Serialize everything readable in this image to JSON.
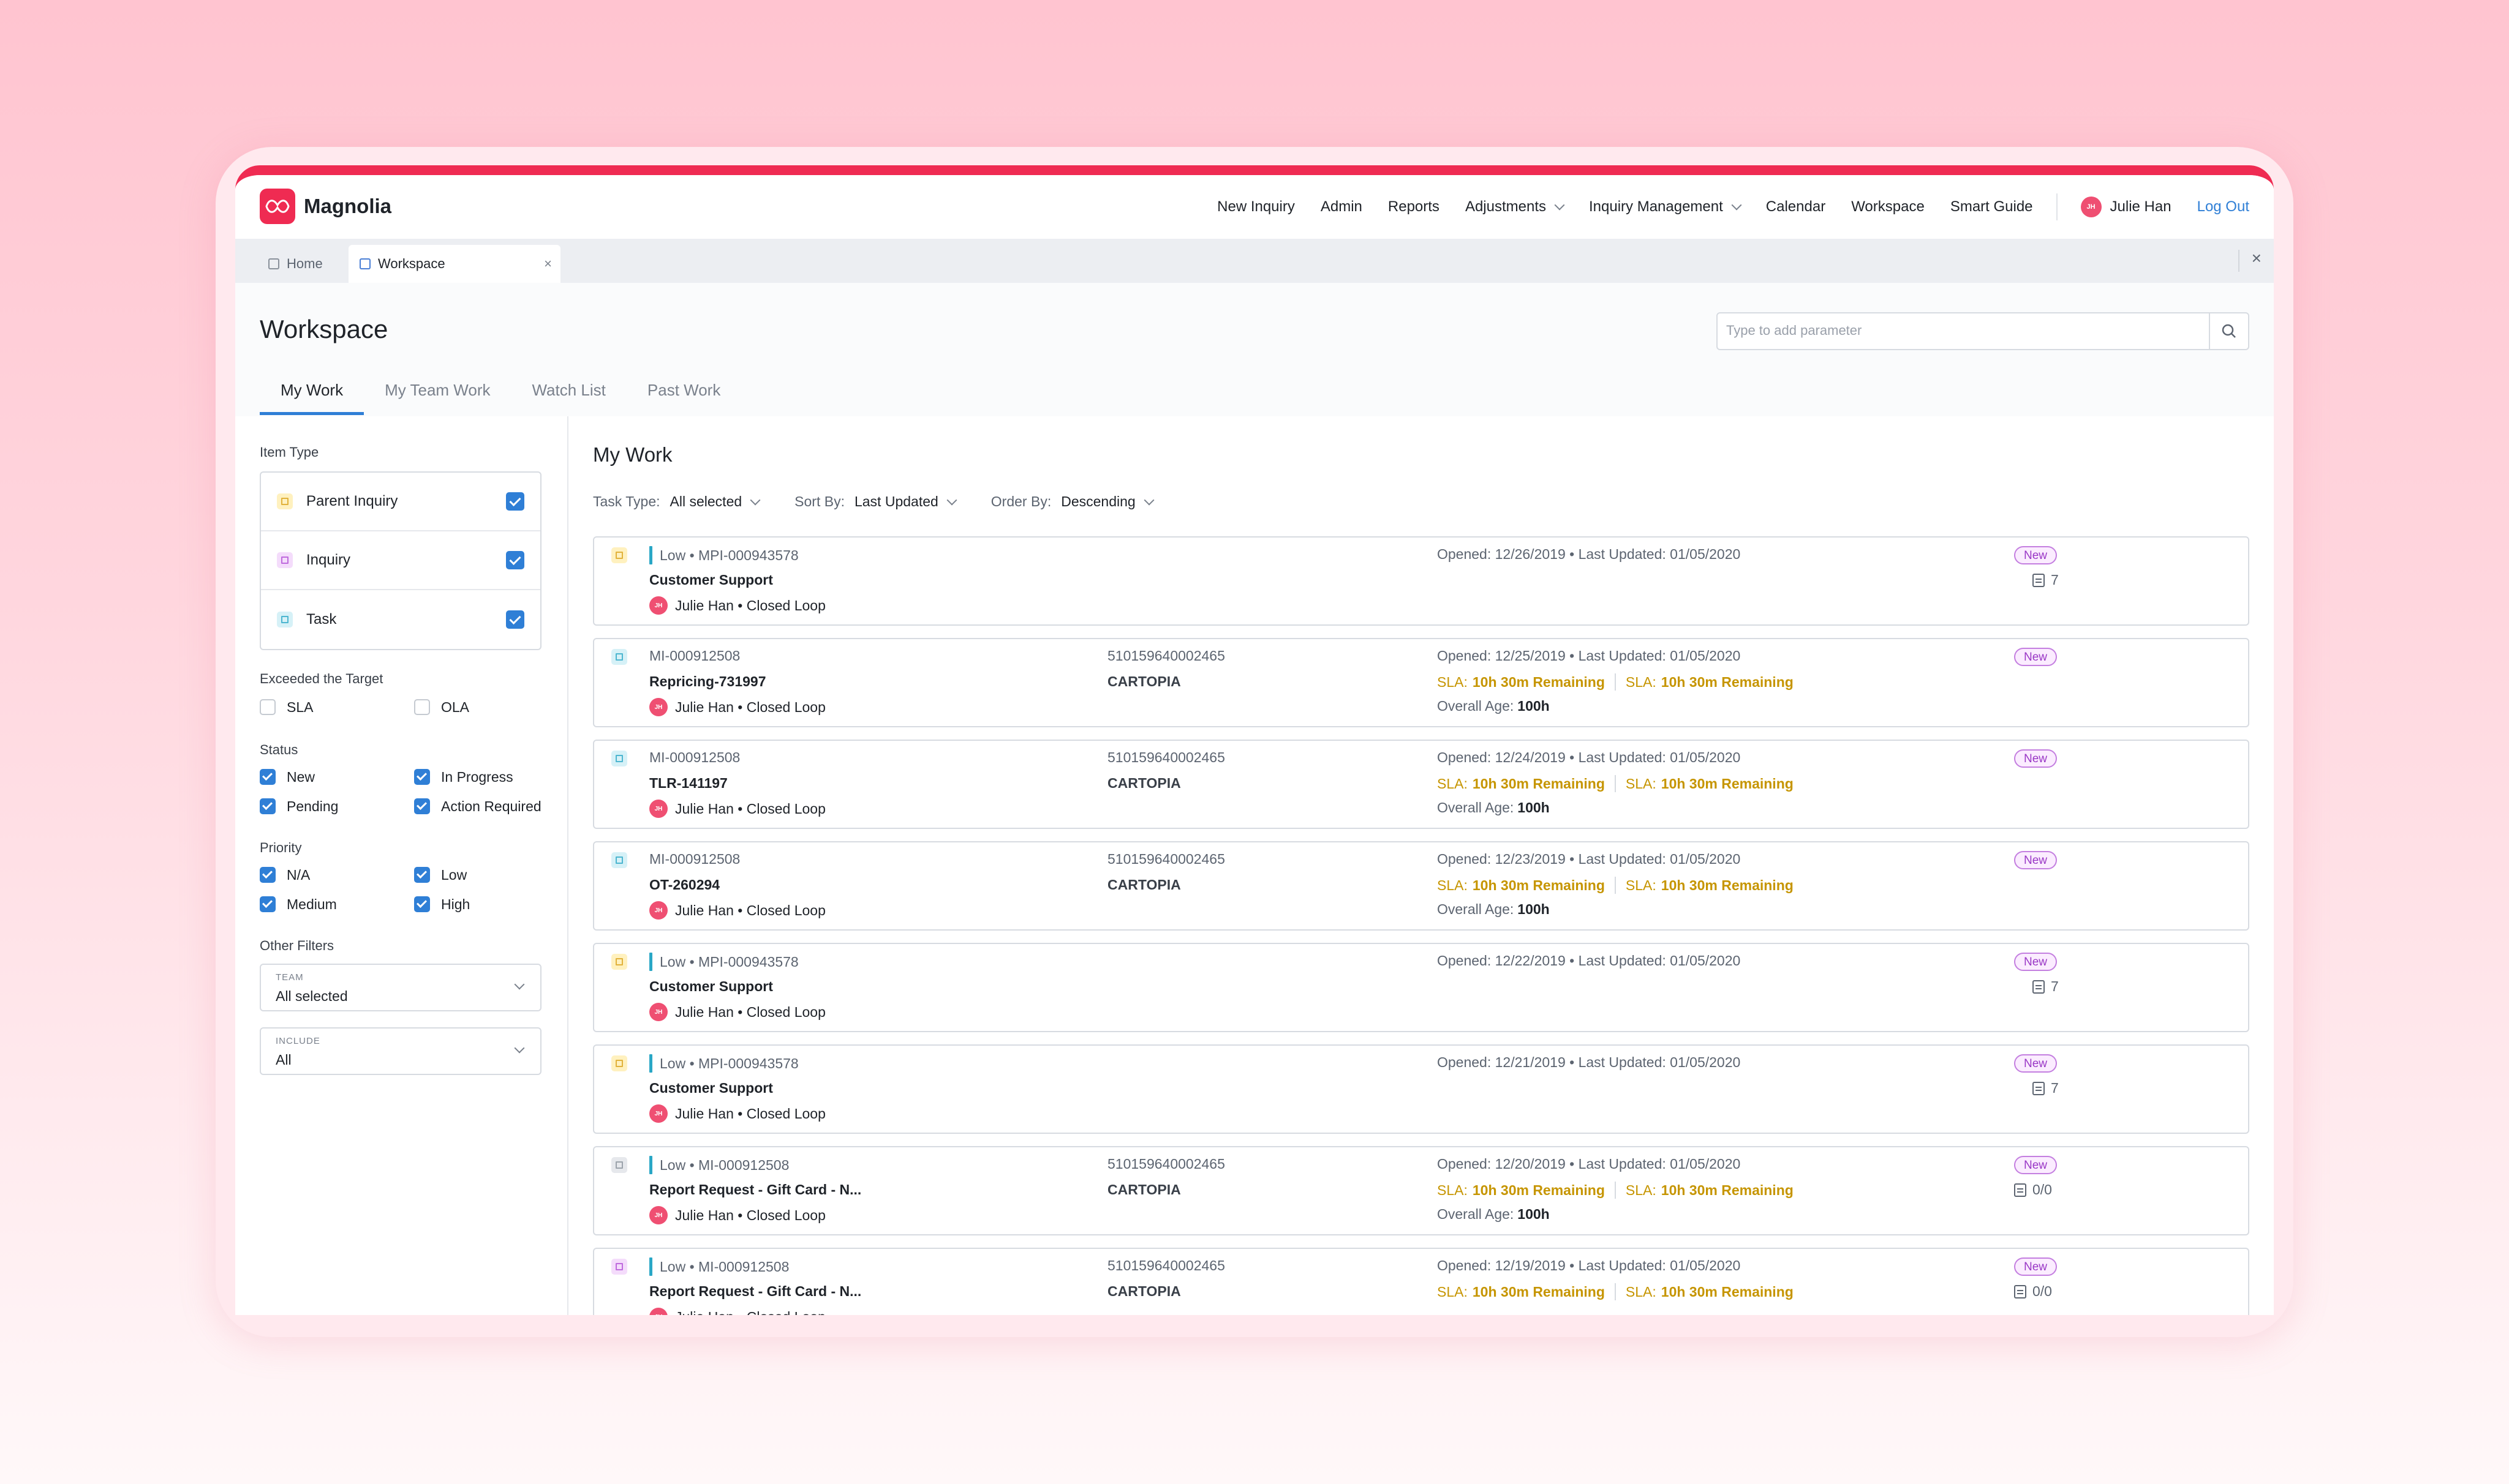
{
  "app": {
    "name": "Magnolia",
    "accent": "#ef2b52",
    "link": "#2f7fd6"
  },
  "nav": {
    "items": [
      "New Inquiry",
      "Admin",
      "Reports",
      "Adjustments",
      "Inquiry Management",
      "Calendar",
      "Workspace",
      "Smart Guide"
    ],
    "user": {
      "initials": "JH",
      "name": "Julie Han"
    },
    "logout": "Log Out"
  },
  "tabs": {
    "home": "Home",
    "active": "Workspace",
    "close": "×"
  },
  "header": {
    "title": "Workspace",
    "search_placeholder": "Type to add parameter",
    "tabs": [
      "My Work",
      "My Team Work",
      "Watch List",
      "Past Work"
    ]
  },
  "filters": {
    "item_type_label": "Item Type",
    "item_types": [
      "Parent Inquiry",
      "Inquiry",
      "Task"
    ],
    "exceeded_label": "Exceeded the Target",
    "exceeded": [
      "SLA",
      "OLA"
    ],
    "status_label": "Status",
    "status": [
      "New",
      "In Progress",
      "Pending",
      "Action Required"
    ],
    "priority_label": "Priority",
    "priority": [
      "N/A",
      "Low",
      "Medium",
      "High"
    ],
    "other_label": "Other Filters",
    "team": {
      "label": "TEAM",
      "value": "All selected"
    },
    "include": {
      "label": "INCLUDE",
      "value": "All"
    }
  },
  "work": {
    "title": "My Work",
    "task_type": {
      "label": "Task Type:",
      "value": "All selected"
    },
    "sort_by": {
      "label": "Sort By:",
      "value": "Last Updated"
    },
    "order_by": {
      "label": "Order By:",
      "value": "Descending"
    },
    "items": [
      {
        "line1": "Low • MPI-000943578",
        "title": "Customer Support",
        "owner": "Julie Han • Closed Loop",
        "dates": "Opened: 12/26/2019 • Last Updated: 01/05/2020",
        "badge": "New",
        "count": "7"
      },
      {
        "line1": "MI-000912508",
        "title": "Repricing-731997",
        "owner": "Julie Han • Closed Loop",
        "account": "510159640002465",
        "client": "CARTOPIA",
        "dates": "Opened: 12/25/2019 • Last Updated: 01/05/2020",
        "sla1": "SLA:",
        "sla1v": "10h 30m Remaining",
        "sla2": "SLA:",
        "sla2v": "10h 30m Remaining",
        "age": "Overall Age:",
        "agev": "100h",
        "badge": "New"
      },
      {
        "line1": "MI-000912508",
        "title": "TLR-141197",
        "owner": "Julie Han • Closed Loop",
        "account": "510159640002465",
        "client": "CARTOPIA",
        "dates": "Opened: 12/24/2019 • Last Updated: 01/05/2020",
        "sla1": "SLA:",
        "sla1v": "10h 30m Remaining",
        "sla2": "SLA:",
        "sla2v": "10h 30m Remaining",
        "age": "Overall Age:",
        "agev": "100h",
        "badge": "New"
      },
      {
        "line1": "MI-000912508",
        "title": "OT-260294",
        "owner": "Julie Han • Closed Loop",
        "account": "510159640002465",
        "client": "CARTOPIA",
        "dates": "Opened: 12/23/2019 • Last Updated: 01/05/2020",
        "sla1": "SLA:",
        "sla1v": "10h 30m Remaining",
        "sla2": "SLA:",
        "sla2v": "10h 30m Remaining",
        "age": "Overall Age:",
        "agev": "100h",
        "badge": "New"
      },
      {
        "line1": "Low • MPI-000943578",
        "title": "Customer Support",
        "owner": "Julie Han • Closed Loop",
        "dates": "Opened: 12/22/2019 • Last Updated: 01/05/2020",
        "badge": "New",
        "count": "7"
      },
      {
        "line1": "Low • MPI-000943578",
        "title": "Customer Support",
        "owner": "Julie Han • Closed Loop",
        "dates": "Opened: 12/21/2019 • Last Updated: 01/05/2020",
        "badge": "New",
        "count": "7"
      },
      {
        "line1": "Low • MI-000912508",
        "title": "Report Request - Gift Card - N...",
        "owner": "Julie Han • Closed Loop",
        "account": "510159640002465",
        "client": "CARTOPIA",
        "dates": "Opened: 12/20/2019 • Last Updated: 01/05/2020",
        "sla1": "SLA:",
        "sla1v": "10h 30m Remaining",
        "sla2": "SLA:",
        "sla2v": "10h 30m Remaining",
        "age": "Overall Age:",
        "agev": "100h",
        "badge": "New",
        "count": "0/0"
      },
      {
        "line1": "Low • MI-000912508",
        "title": "Report Request - Gift Card - N...",
        "owner": "Julie Han • Closed Loop",
        "account": "510159640002465",
        "client": "CARTOPIA",
        "dates": "Opened: 12/19/2019 • Last Updated: 01/05/2020",
        "sla1": "SLA:",
        "sla1v": "10h 30m Remaining",
        "sla2": "SLA:",
        "sla2v": "10h 30m Remaining",
        "badge": "New",
        "count": "0/0"
      }
    ]
  }
}
